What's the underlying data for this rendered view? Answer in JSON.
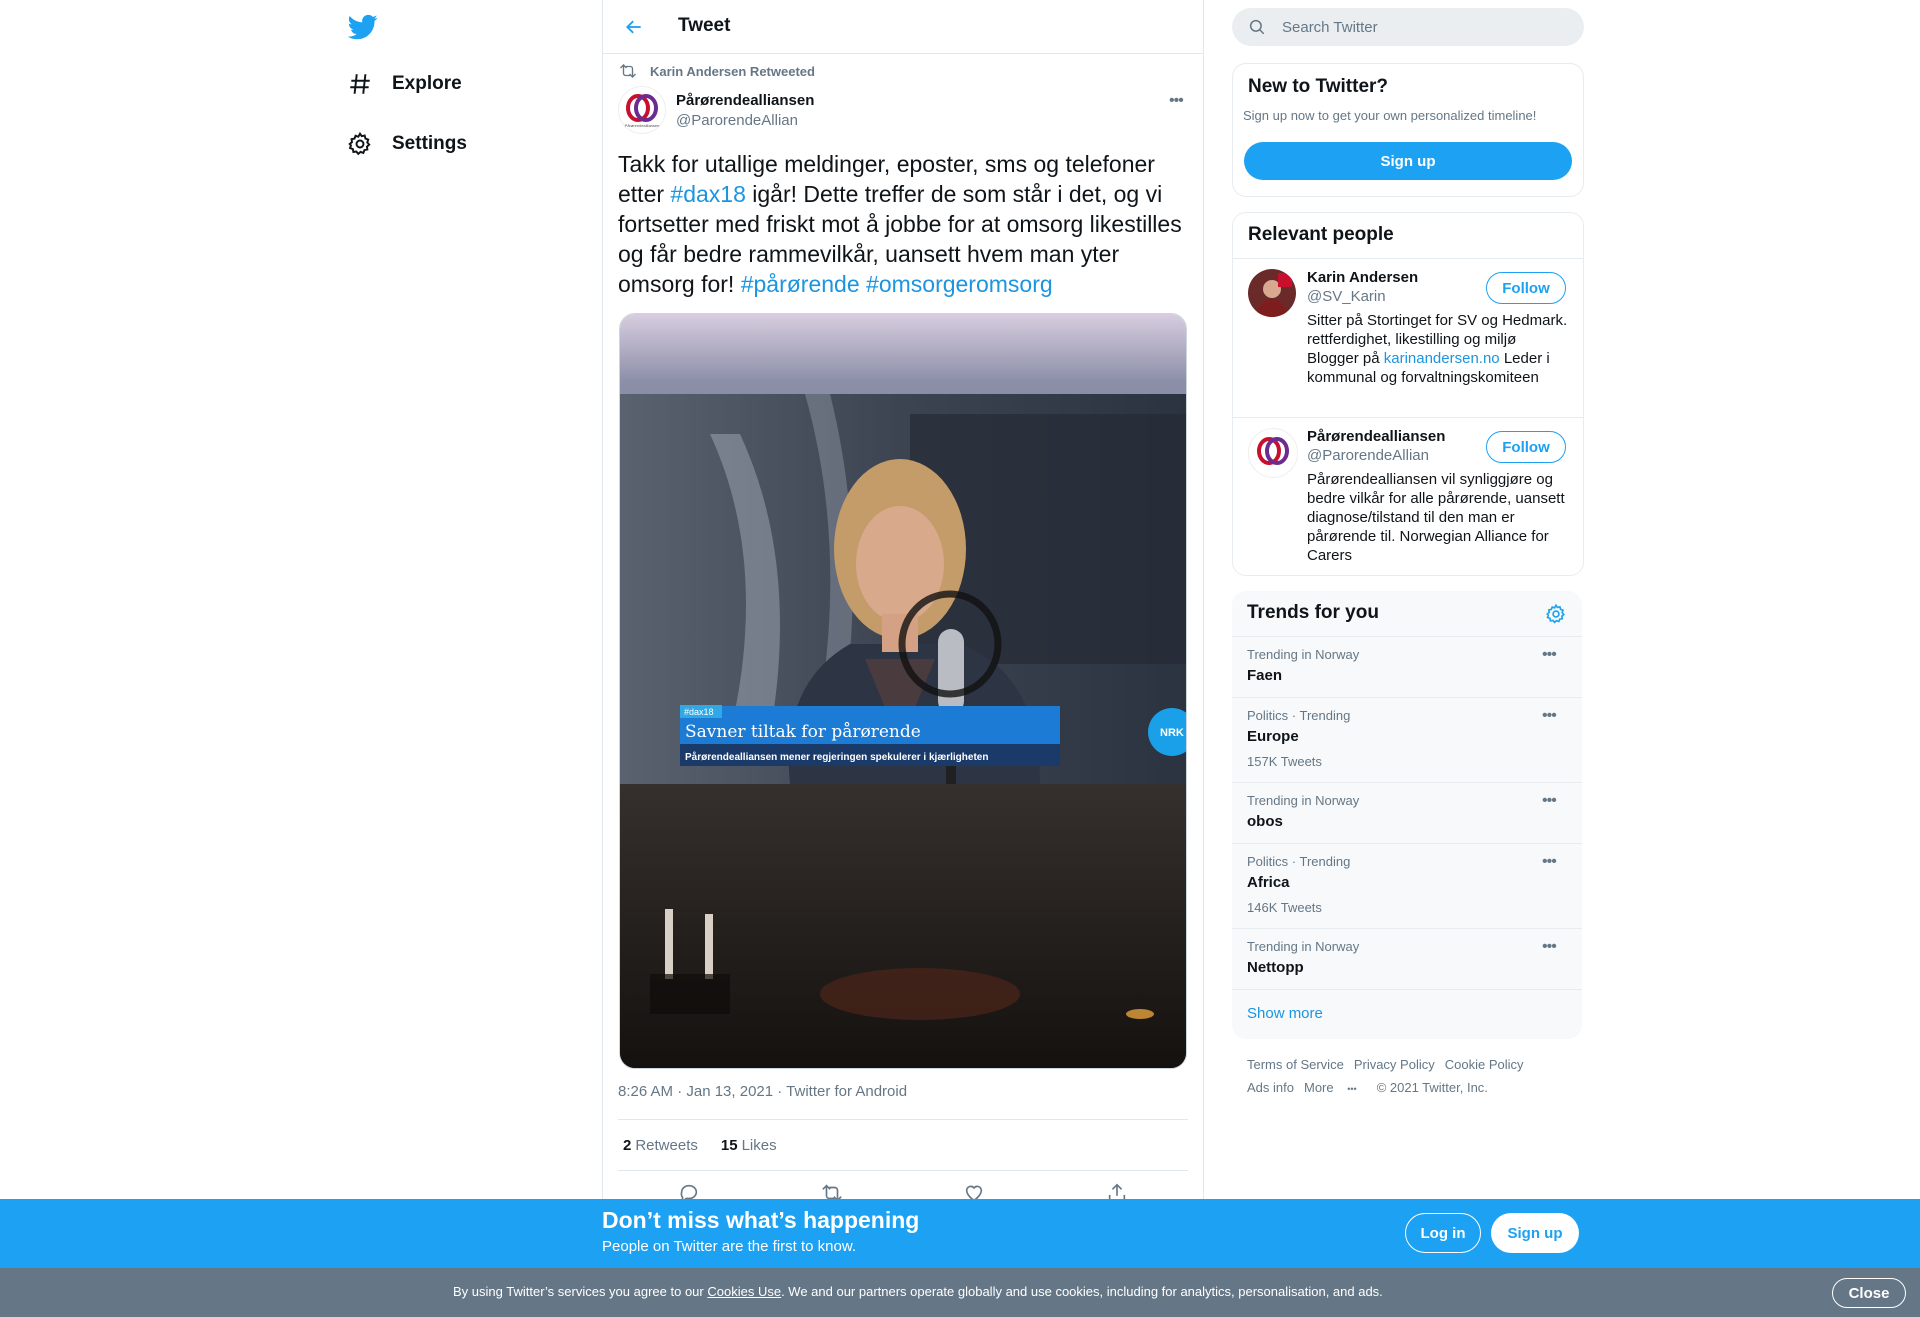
{
  "colors": {
    "brand": "#1da1f2",
    "link": "#1b95e0",
    "muted": "#657786",
    "cookie_bar": "#657786"
  },
  "nav": {
    "logo_icon": "twitter-bird-icon",
    "items": [
      {
        "label": "Explore",
        "icon": "hashtag-icon"
      },
      {
        "label": "Settings",
        "icon": "gear-icon"
      }
    ]
  },
  "header": {
    "title": "Tweet",
    "back_icon": "arrow-left-icon"
  },
  "tweet": {
    "retweeted_by": "Karin Andersen Retweeted",
    "author_name": "Pårørendealliansen",
    "author_handle": "@ParorendeAllian",
    "avatar_caption": "Pårørendealliansen",
    "text_parts": [
      "Takk for utallige meldinger, eposter, sms og telefoner etter ",
      "#dax18",
      " igår! Dette treffer de som står i det, og vi fortsetter med friskt mot å jobbe for at omsorg likestilles og får bedre rammevilkår, uansett hvem man yter omsorg for! ",
      "#pårørende",
      " ",
      "#omsorgeromsorg"
    ],
    "media": {
      "lower_third_tag": "#dax18",
      "lower_third_title": "Savner tiltak for pårørende",
      "lower_third_sub": "Pårørendealliansen mener regjeringen spekulerer i kjærligheten",
      "channel_mark": "NRK"
    },
    "timestamp": "8:26 AM · Jan 13, 2021 · Twitter for Android",
    "retweets_count": "2",
    "retweets_label": "Retweets",
    "likes_count": "15",
    "likes_label": "Likes"
  },
  "search": {
    "placeholder": "Search Twitter"
  },
  "new_to_twitter": {
    "title": "New to Twitter?",
    "subtitle": "Sign up now to get your own personalized timeline!",
    "button": "Sign up"
  },
  "relevant": {
    "title": "Relevant people",
    "people": [
      {
        "name": "Karin Andersen",
        "handle": "@SV_Karin",
        "bio_before": "Sitter på Stortinget for SV og Hedmark. rettferdighet, likestilling og miljø Blogger på ",
        "bio_link": "karinandersen.no",
        "bio_after": " Leder i kommunal og forvaltningskomiteen",
        "follow": "Follow"
      },
      {
        "name": "Pårørendealliansen",
        "handle": "@ParorendeAllian",
        "bio_before": "Pårørendealliansen vil synliggjøre og bedre vilkår for alle pårørende, uansett diagnose/tilstand til den man er pårørende til. Norwegian Alliance for Carers",
        "bio_link": "",
        "bio_after": "",
        "follow": "Follow"
      }
    ]
  },
  "trends": {
    "title": "Trends for you",
    "items": [
      {
        "context": "Trending in Norway",
        "name": "Faen",
        "count": ""
      },
      {
        "context": "Politics · Trending",
        "name": "Europe",
        "count": "157K Tweets"
      },
      {
        "context": "Trending in Norway",
        "name": "obos",
        "count": ""
      },
      {
        "context": "Politics · Trending",
        "name": "Africa",
        "count": "146K Tweets"
      },
      {
        "context": "Trending in Norway",
        "name": "Nettopp",
        "count": ""
      }
    ],
    "show_more": "Show more"
  },
  "footer": {
    "links": [
      "Terms of Service",
      "Privacy Policy",
      "Cookie Policy",
      "Ads info",
      "More"
    ],
    "copyright": "© 2021 Twitter, Inc."
  },
  "bottom_bar": {
    "title": "Don’t miss what’s happening",
    "subtitle": "People on Twitter are the first to know.",
    "login": "Log in",
    "signup": "Sign up"
  },
  "cookie": {
    "before": "By using Twitter’s services you agree to our ",
    "link": "Cookies Use",
    "after": ". We and our partners operate globally and use cookies, including for analytics, personalisation, and ads.",
    "close": "Close"
  }
}
